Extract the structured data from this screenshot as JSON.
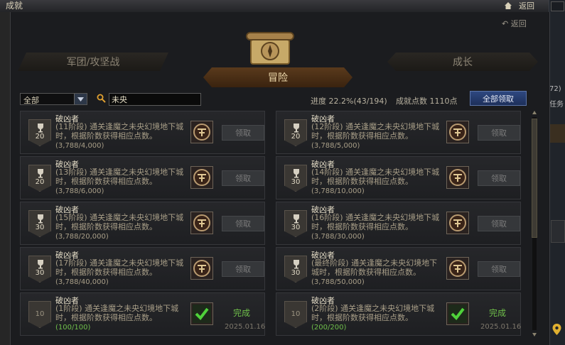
{
  "window": {
    "title": "成就",
    "return_label": "返回",
    "sub_return_label": "返回"
  },
  "tabs": {
    "left": "军团/攻坚战",
    "active": "冒险",
    "right": "成长"
  },
  "toolbar": {
    "filter_value": "全部",
    "search_value": "未央",
    "progress_text": "进度 22.2%(43/194)",
    "points_text": "成就点数 1110点",
    "claim_all_label": "全部领取"
  },
  "claim_label": "领取",
  "done_label": "完成",
  "achievements": [
    {
      "title": "破凶者",
      "desc": "(11阶段) 通关逢魔之未央幻境地下城时，根据阶数获得相应点数。",
      "progress": "(3,788/4,000)",
      "points": "20",
      "done": false
    },
    {
      "title": "破凶者",
      "desc": "(12阶段) 通关逢魔之未央幻境地下城时，根据阶数获得相应点数。",
      "progress": "(3,788/5,000)",
      "points": "20",
      "done": false
    },
    {
      "title": "破凶者",
      "desc": "(13阶段) 通关逢魔之未央幻境地下城时，根据阶数获得相应点数。",
      "progress": "(3,788/6,000)",
      "points": "20",
      "done": false
    },
    {
      "title": "破凶者",
      "desc": "(14阶段) 通关逢魔之未央幻境地下城时，根据阶数获得相应点数。",
      "progress": "(3,788/10,000)",
      "points": "30",
      "done": false
    },
    {
      "title": "破凶者",
      "desc": "(15阶段) 通关逢魔之未央幻境地下城时，根据阶数获得相应点数。",
      "progress": "(3,788/20,000)",
      "points": "30",
      "done": false
    },
    {
      "title": "破凶者",
      "desc": "(16阶段) 通关逢魔之未央幻境地下城时，根据阶数获得相应点数。",
      "progress": "(3,788/30,000)",
      "points": "30",
      "done": false
    },
    {
      "title": "破凶者",
      "desc": "(17阶段) 通关逢魔之未央幻境地下城时，根据阶数获得相应点数。",
      "progress": "(3,788/40,000)",
      "points": "30",
      "done": false
    },
    {
      "title": "破凶者",
      "desc": "(最终阶段) 通关逢魔之未央幻境地下城时，根据阶数获得相应点数。",
      "progress": "(3,788/50,000)",
      "points": "30",
      "done": false
    },
    {
      "title": "破凶者",
      "desc": "(1阶段) 通关逢魔之未央幻境地下城时，根据阶数获得相应点数。",
      "progress": "(100/100)",
      "points": "10",
      "done": true,
      "date": "2025.01.16"
    },
    {
      "title": "破凶者",
      "desc": "(2阶段) 通关逢魔之未央幻境地下城时，根据阶数获得相应点数。",
      "progress": "(200/200)",
      "points": "10",
      "done": true,
      "date": "2025.01.16"
    }
  ],
  "side_text": {
    "a": "72)",
    "b": "任务",
    "c": "的话"
  }
}
